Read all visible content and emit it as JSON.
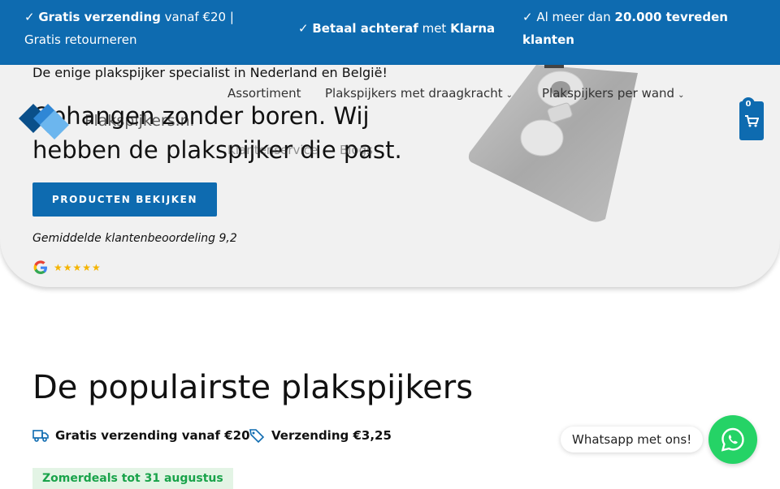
{
  "topbar": {
    "item1_prefix": "✓ ",
    "item1_bold": "Gratis verzending",
    "item1_rest": " vanaf €20 |",
    "item1_line2": "Gratis retourneren",
    "item2_prefix": "✓ ",
    "item2_bold1": "Betaal achteraf",
    "item2_mid": " met ",
    "item2_bold2": "Klarna",
    "item3_prefix": "✓ Al meer dan ",
    "item3_bold1": "20.000 tevreden",
    "item3_bold2": "klanten"
  },
  "hero": {
    "subtitle": "De enige plakspijker specialist in Nederland en België!",
    "title": "Ophangen zonder boren. Wij hebben de plakspijker die past.",
    "cta": "PRODUCTEN BEKIJKEN",
    "rating_text": "Gemiddelde klantenbeoordeling 9,2",
    "stars": "★★★★★"
  },
  "header": {
    "brand": "Plakspijkers.nl",
    "nav": {
      "assortiment": "Assortiment",
      "draagkracht": "Plakspijkers met draagkracht",
      "per_wand": "Plakspijkers per wand",
      "klantenservice": "Klantenservice",
      "blogs": "Blogs"
    },
    "cart_count": "0"
  },
  "section": {
    "title": "De populairste plakspijkers",
    "feature1": "Gratis verzending vanaf €20",
    "feature2": "Verzending €3,25",
    "deal_badge": "Zomerdeals tot 31 augustus"
  },
  "whatsapp": {
    "tooltip": "Whatsapp met ons!"
  },
  "colors": {
    "primary": "#0e6bb0",
    "whatsapp": "#25d366",
    "deal_text": "#19a34a"
  },
  "icons": {
    "truck": "truck-icon",
    "tag": "tag-icon",
    "cart": "cart-icon",
    "whatsapp": "whatsapp-icon",
    "google": "google-icon",
    "chevron": "chevron-down-icon"
  }
}
